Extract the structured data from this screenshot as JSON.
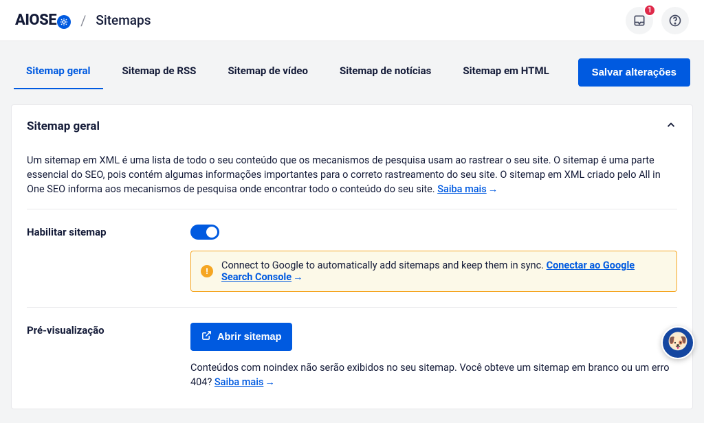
{
  "header": {
    "brand_prefix": "AIO",
    "brand_suffix": "SE",
    "page_title": "Sitemaps",
    "notif_count": "1"
  },
  "tabs": [
    {
      "label": "Sitemap geral",
      "active": true
    },
    {
      "label": "Sitemap de RSS",
      "active": false
    },
    {
      "label": "Sitemap de vídeo",
      "active": false
    },
    {
      "label": "Sitemap de notícias",
      "active": false
    },
    {
      "label": "Sitemap em HTML",
      "active": false
    }
  ],
  "save_button": "Salvar alterações",
  "card": {
    "title": "Sitemap geral",
    "description": "Um sitemap em XML é uma lista de todo o seu conteúdo que os mecanismos de pesquisa usam ao rastrear o seu site. O sitemap é uma parte essencial do SEO, pois contém algumas informações importantes para o correto rastreamento do seu site. O sitemap em XML criado pelo All in One SEO informa aos mecanismos de pesquisa onde encontrar todo o conteúdo do seu site. ",
    "learn_more": "Saiba mais"
  },
  "enable_row": {
    "label": "Habilitar sitemap",
    "alert_text": "Connect to Google to automatically add sitemaps and keep them in sync. ",
    "alert_link": "Conectar ao Google Search Console"
  },
  "preview_row": {
    "label": "Pré-visualização",
    "open_button": "Abrir sitemap",
    "note_text": "Conteúdos com noindex não serão exibidos no seu sitemap. Você obteve um sitemap em branco ou um erro 404? ",
    "learn_more": "Saiba mais"
  }
}
